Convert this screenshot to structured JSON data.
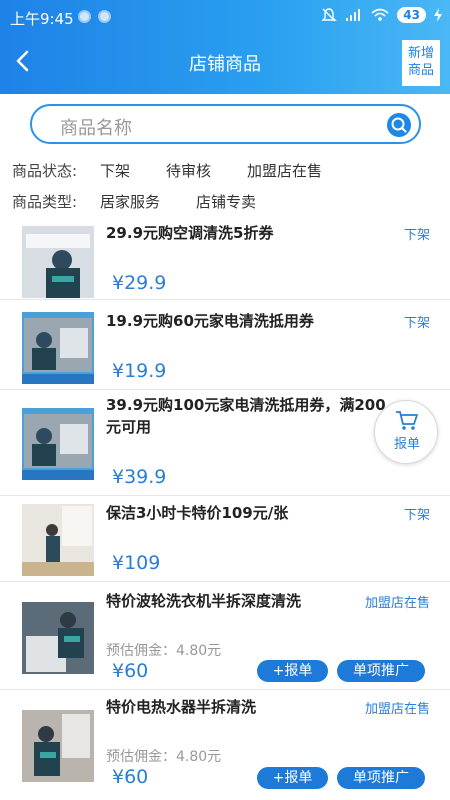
{
  "status_bar": {
    "time": "上午9:45",
    "battery": "43"
  },
  "header": {
    "title": "店铺商品",
    "new_button_line1": "新增",
    "new_button_line2": "商品"
  },
  "search": {
    "placeholder": "商品名称"
  },
  "filters": {
    "status_label": "商品状态:",
    "status_options": [
      "下架",
      "待审核",
      "加盟店在售"
    ],
    "type_label": "商品类型:",
    "type_options": [
      "居家服务",
      "店铺专卖"
    ]
  },
  "products": [
    {
      "name": "29.9元购空调清洗5折券",
      "status": "下架",
      "price": "¥29.9"
    },
    {
      "name": "19.9元购60元家电清洗抵用券",
      "status": "下架",
      "price": "¥19.9"
    },
    {
      "name_line1": "39.9元购100元家电清洗抵用券，满200",
      "name_line2": "元可用",
      "status": "下架",
      "price": "¥39.9"
    },
    {
      "name": "保洁3小时卡特价109元/张",
      "status": "下架",
      "price": "¥109"
    },
    {
      "name": "特价波轮洗衣机半拆深度清洗",
      "status": "加盟店在售",
      "commission": "预估佣金：4.80元",
      "price": "¥60",
      "report_label": "+报单",
      "promo_label": "单项推广"
    },
    {
      "name": "特价电热水器半拆清洗",
      "status": "加盟店在售",
      "commission": "预估佣金：4.80元",
      "price": "¥60",
      "report_label": "+报单",
      "promo_label": "单项推广"
    }
  ],
  "float_button": {
    "label": "报单"
  },
  "colors": {
    "header_blue": "#1e82e6",
    "accent_blue": "#2a7fd4"
  }
}
